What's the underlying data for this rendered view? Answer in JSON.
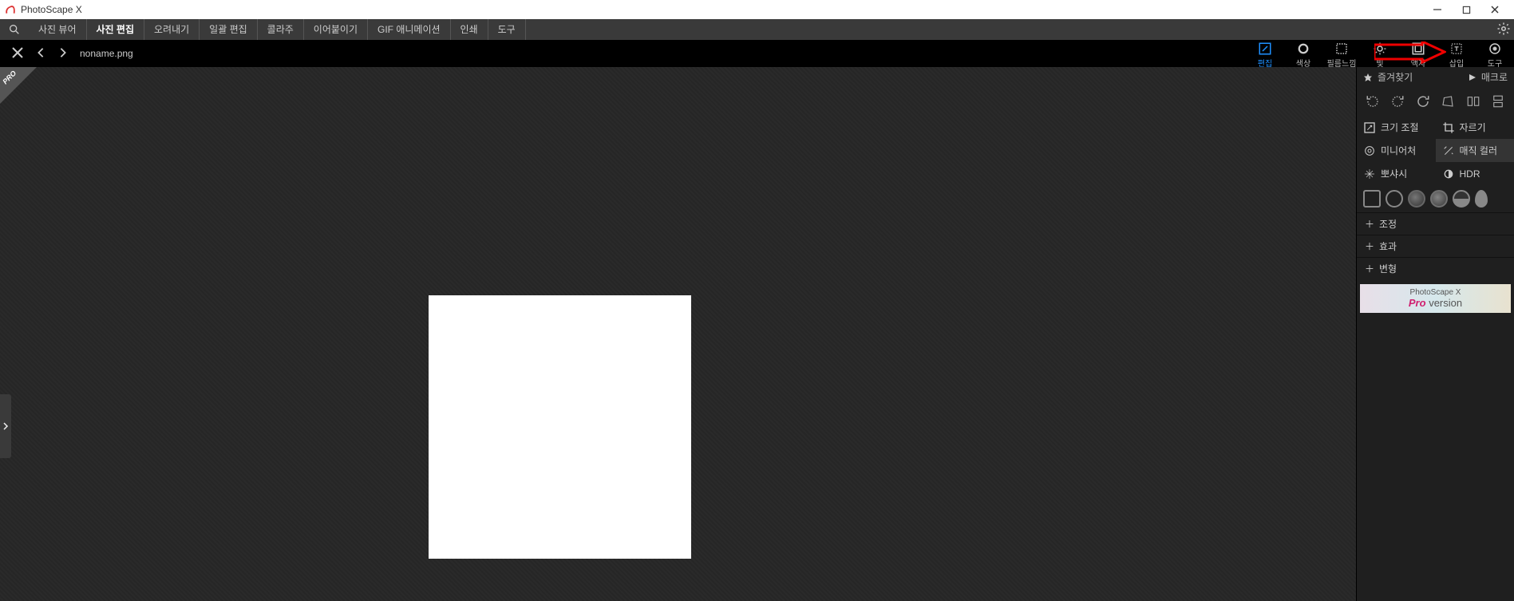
{
  "app": {
    "title": "PhotoScape X"
  },
  "menu": {
    "items": [
      "사진 뷰어",
      "사진 편집",
      "오려내기",
      "일괄 편집",
      "콜라주",
      "이어붙이기",
      "GIF 애니메이션",
      "인쇄",
      "도구"
    ],
    "activeIndex": 1
  },
  "breadcrumb": {
    "filename": "noname.png"
  },
  "rtabs": [
    {
      "key": "edit",
      "label": "편집"
    },
    {
      "key": "color",
      "label": "색상"
    },
    {
      "key": "film",
      "label": "필름느낌"
    },
    {
      "key": "light",
      "label": "빛"
    },
    {
      "key": "frame",
      "label": "액자"
    },
    {
      "key": "insert",
      "label": "삽입"
    },
    {
      "key": "tools",
      "label": "도구"
    }
  ],
  "rtabActive": 0,
  "panel": {
    "favorites": "즐겨찾기",
    "macro": "매크로",
    "resize": "크기 조절",
    "crop": "자르기",
    "miniature": "미니어처",
    "magic": "매직 컬러",
    "sharp": "뽀샤시",
    "hdr": "HDR",
    "adjust": "조정",
    "effect": "효과",
    "transform": "변형"
  },
  "promo": {
    "line1": "PhotoScape X",
    "pro": "Pro",
    "version": "version"
  },
  "corner": "PRO"
}
